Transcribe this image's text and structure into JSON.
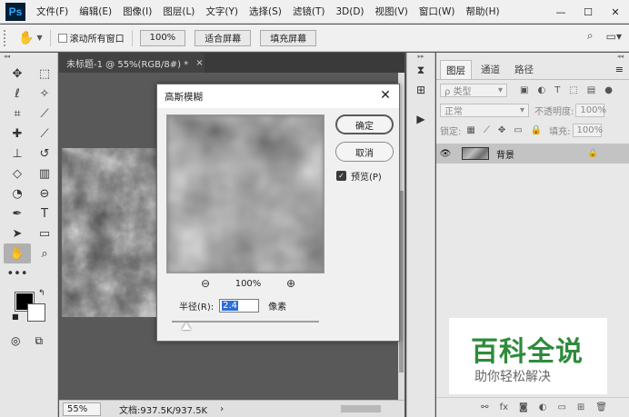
{
  "app": {
    "logo": "Ps"
  },
  "menu": [
    "文件(F)",
    "编辑(E)",
    "图像(I)",
    "图层(L)",
    "文字(Y)",
    "选择(S)",
    "滤镜(T)",
    "3D(D)",
    "视图(V)",
    "窗口(W)",
    "帮助(H)"
  ],
  "window_controls": {
    "minimize": "—",
    "maximize": "☐",
    "close": "✕"
  },
  "options": {
    "scroll_all_label": "滚动所有窗口",
    "btn_100": "100%",
    "btn_fit": "适合屏幕",
    "btn_fill": "填充屏幕"
  },
  "document": {
    "tab_title": "未标题-1 @ 55%(RGB/8#) *",
    "tab_close": "×",
    "zoom": "55%",
    "doc_info": "文档:937.5K/937.5K",
    "arrow": "›"
  },
  "layers_panel": {
    "tabs": [
      "图层",
      "通道",
      "路径"
    ],
    "filter_kind": "ρ 类型",
    "blend_mode": "正常",
    "opacity_label": "不透明度:",
    "opacity_value": "100%",
    "lock_label": "锁定:",
    "fill_label": "填充:",
    "fill_value": "100%",
    "layer_name": "背景"
  },
  "dialog": {
    "title": "高斯模糊",
    "close": "✕",
    "ok_label": "确定",
    "cancel_label": "取消",
    "preview_label": "预览(P)",
    "preview_checked": "✓",
    "zoom_value": "100%",
    "radius_label": "半径(R):",
    "radius_value": "2.4",
    "radius_unit": "像素",
    "slider_fraction": 0.1
  },
  "watermark": {
    "title": "百科全说",
    "subtitle": "助你轻松解决"
  },
  "colors": {
    "foreground": "#000000",
    "background": "#ffffff",
    "accent": "#2b6fd6",
    "watermark_green": "#2e8b3a"
  }
}
